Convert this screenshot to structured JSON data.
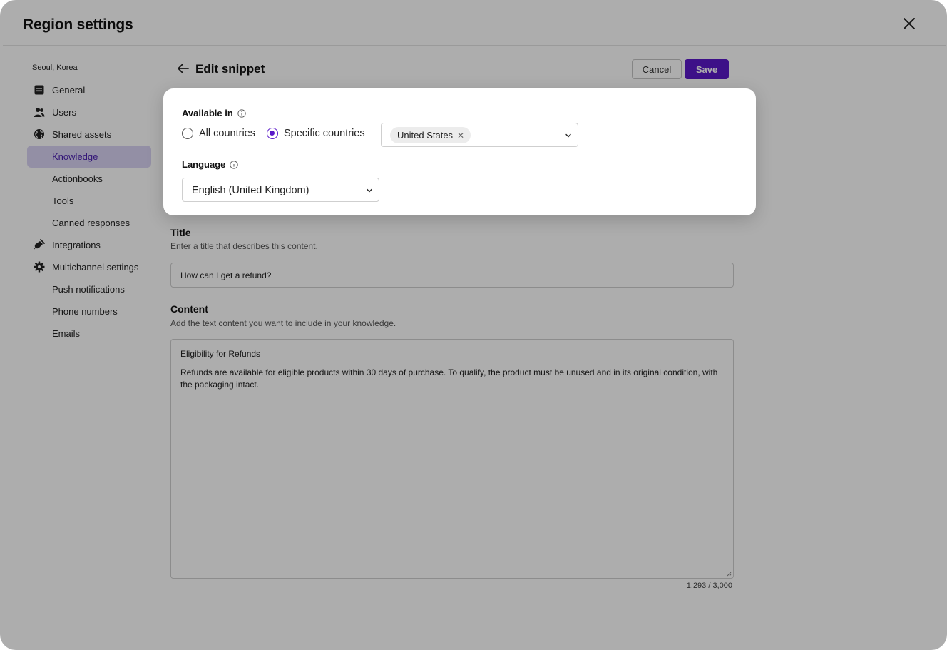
{
  "window": {
    "title": "Region settings"
  },
  "sidebar": {
    "region": "Seoul, Korea",
    "items": [
      {
        "label": "General",
        "icon": "document-icon"
      },
      {
        "label": "Users",
        "icon": "users-icon"
      },
      {
        "label": "Shared assets",
        "icon": "globe-icon"
      },
      {
        "label": "Knowledge",
        "icon": "",
        "active": true
      },
      {
        "label": "Actionbooks",
        "icon": ""
      },
      {
        "label": "Tools",
        "icon": ""
      },
      {
        "label": "Canned responses",
        "icon": ""
      },
      {
        "label": "Integrations",
        "icon": "plug-icon"
      },
      {
        "label": "Multichannel settings",
        "icon": "gear-icon"
      },
      {
        "label": "Push notifications",
        "icon": ""
      },
      {
        "label": "Phone numbers",
        "icon": ""
      },
      {
        "label": "Emails",
        "icon": ""
      }
    ]
  },
  "editor": {
    "page_title": "Edit snippet",
    "cancel_label": "Cancel",
    "save_label": "Save",
    "title_label": "Title",
    "title_help": "Enter a title that describes this content.",
    "title_value": "How can I get a refund?",
    "content_label": "Content",
    "content_help": "Add the text content you want to include in your knowledge.",
    "content_heading": "Eligibility for Refunds",
    "content_body": "Refunds are available for eligible products within 30 days of purchase. To qualify, the product must be unused and in its original condition, with the packaging intact.",
    "char_count": "1,293 / 3,000"
  },
  "popover": {
    "available_label": "Available in",
    "option_all": "All countries",
    "option_specific": "Specific countries",
    "selected_option": "Specific countries",
    "country_chip": "United States",
    "language_label": "Language",
    "language_value": "English (United Kingdom)"
  },
  "colors": {
    "accent": "#5a18c9",
    "active_nav_bg": "#d9d3f3",
    "overlay": "rgba(0,0,0,0.32)"
  }
}
